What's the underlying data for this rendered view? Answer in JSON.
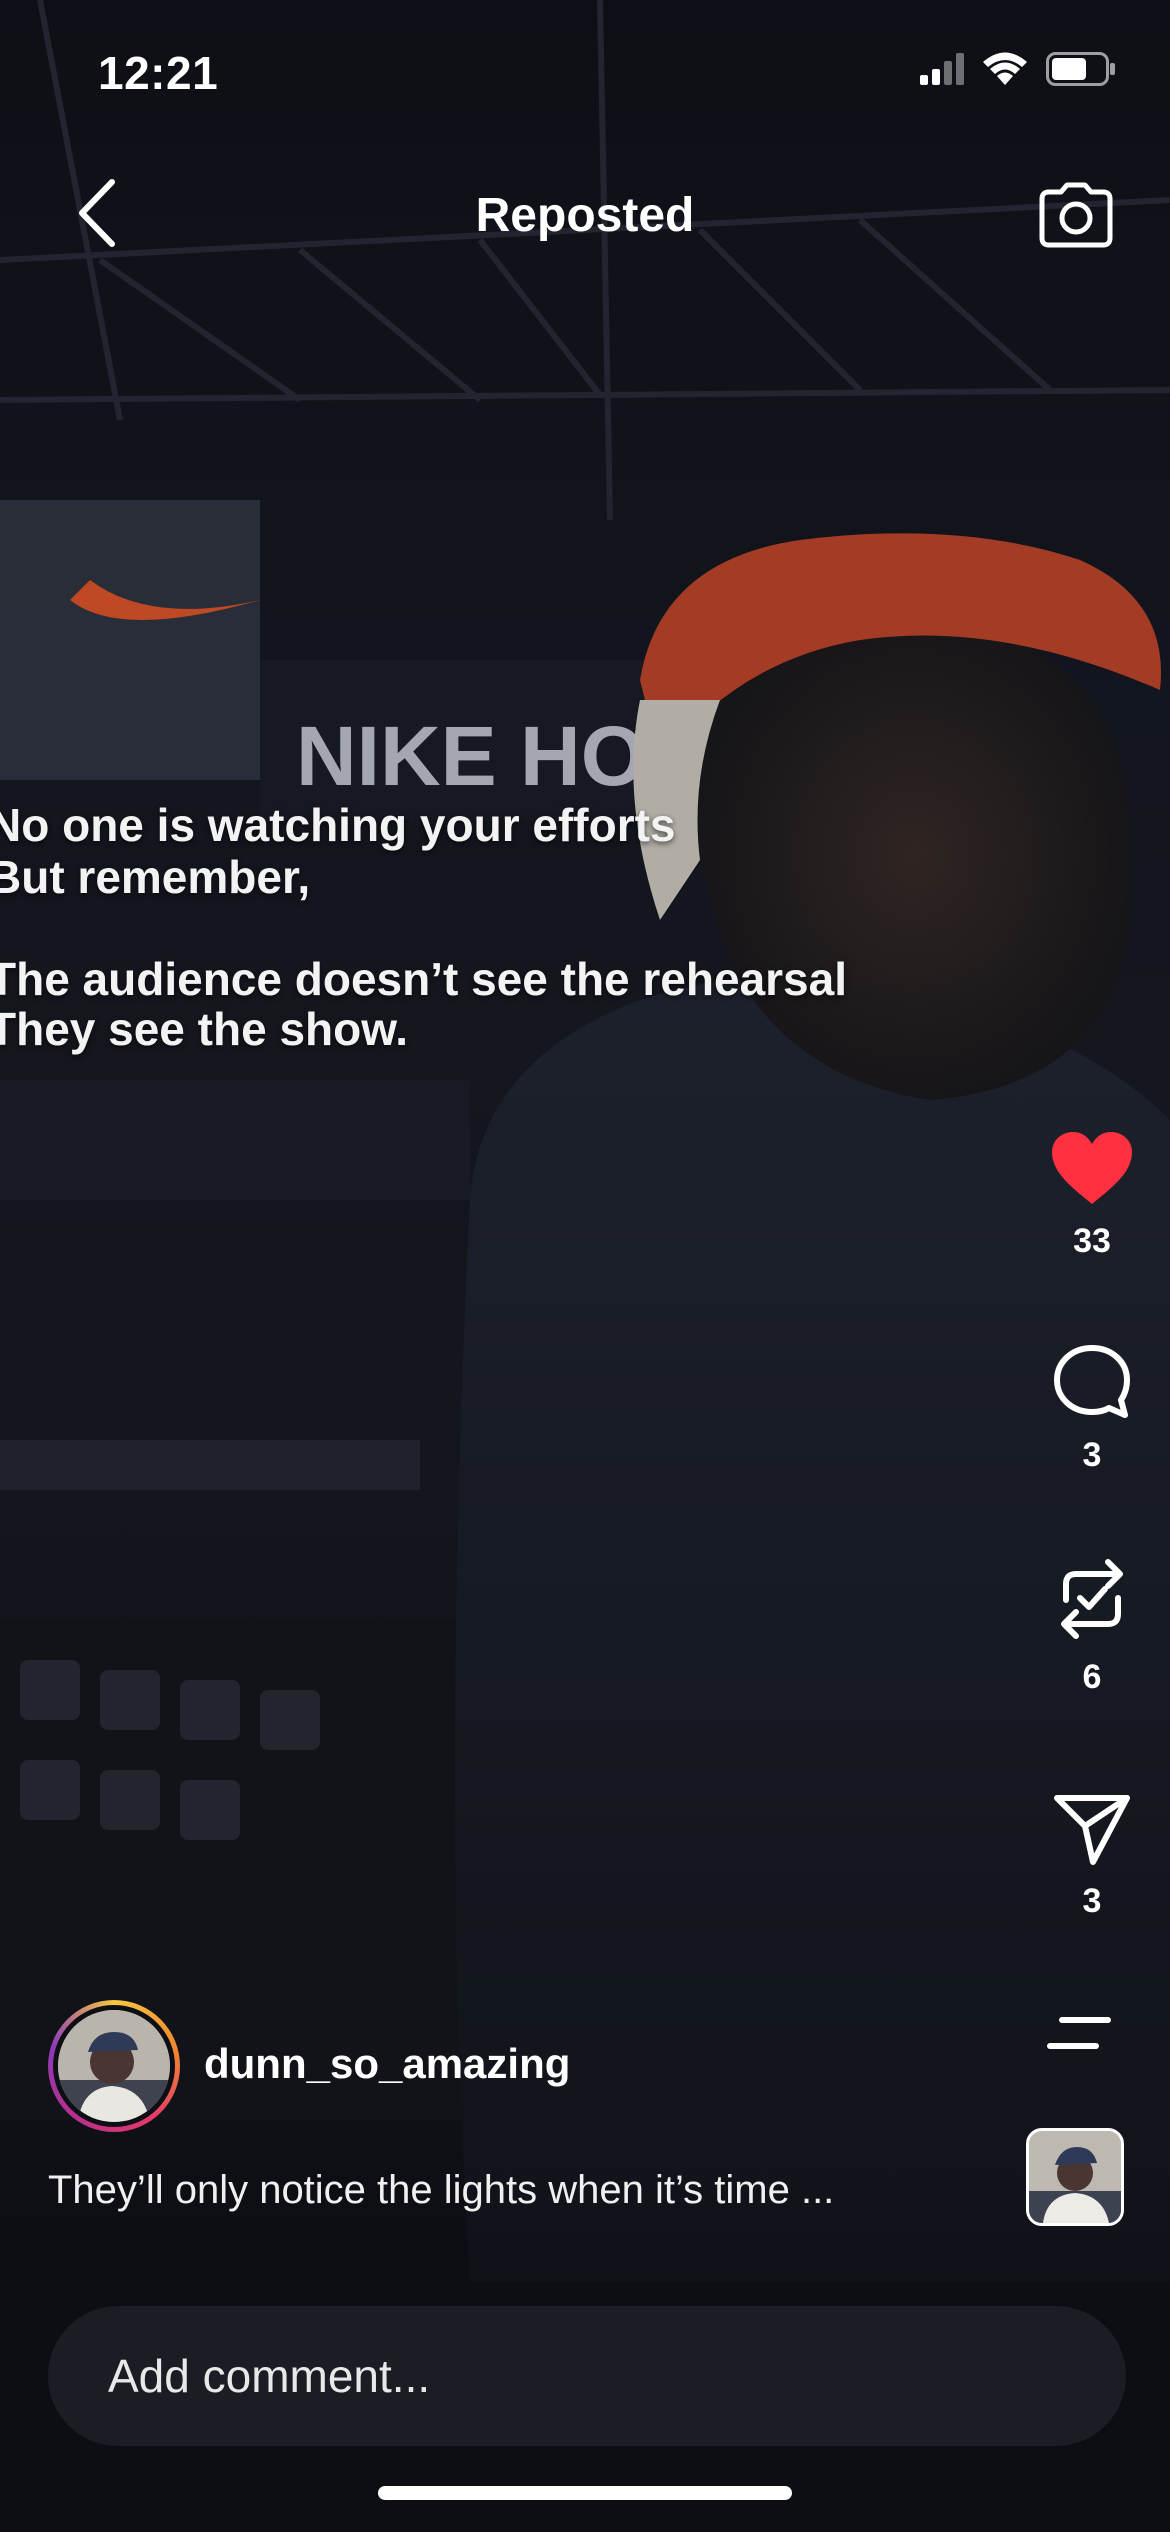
{
  "status_bar": {
    "time": "12:21",
    "signal_icon": "cellular-signal-icon",
    "wifi_icon": "wifi-icon",
    "battery_icon": "battery-icon"
  },
  "header": {
    "title": "Reposted",
    "back_icon": "chevron-left-icon",
    "camera_icon": "camera-icon"
  },
  "video": {
    "scene_sign_text": "NIKE HOC",
    "overlay_text": {
      "line1": "No one is watching your efforts",
      "line2": "But remember,",
      "line3": "The audience doesn’t see the rehearsal",
      "line4": "They see the show."
    }
  },
  "actions": {
    "like": {
      "icon": "heart-icon",
      "count": "33",
      "liked": true,
      "color": "#ff3040"
    },
    "comment": {
      "icon": "comment-bubble-icon",
      "count": "3"
    },
    "repost": {
      "icon": "repost-icon",
      "count": "6",
      "reposted": true
    },
    "share": {
      "icon": "paper-plane-icon",
      "count": "3"
    },
    "more": {
      "icon": "menu-lines-icon"
    },
    "audio": {
      "icon": "audio-thumbnail"
    }
  },
  "post": {
    "username": "dunn_so_amazing",
    "caption": "They’ll only notice the lights when it’s time ..."
  },
  "comment_bar": {
    "placeholder": "Add comment..."
  }
}
